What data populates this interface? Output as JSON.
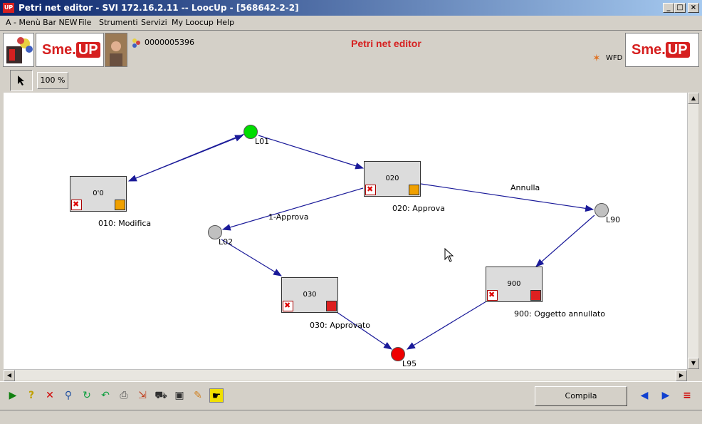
{
  "window": {
    "title": "Petri net editor - SVI 172.16.2.11 -- LoocUp - [568642-2-2]",
    "app_icon_text": "UP",
    "buttons": {
      "minimize": "_",
      "maximize": "□",
      "close": "×"
    }
  },
  "menu": {
    "items": [
      "A - Menù Bar NEW",
      "File",
      "Strumenti",
      "Servizi",
      "My Loocup",
      "Help"
    ]
  },
  "header": {
    "user_code": "0000005396",
    "title": "Petri net editor",
    "wfd": "WFD",
    "logo_left": {
      "text": "Sme.",
      "badge": "UP"
    },
    "logo_right": {
      "text": "Sme.",
      "badge": "UP"
    }
  },
  "toolbar": {
    "zoom": "100 %"
  },
  "graph": {
    "places": [
      {
        "id": "L01",
        "label": "L01",
        "color": "#00dd00"
      },
      {
        "id": "L02",
        "label": "L02",
        "color": "#c0c0c0"
      },
      {
        "id": "L90",
        "label": "L90",
        "color": "#c0c0c0"
      },
      {
        "id": "L95",
        "label": "L95",
        "color": "#ee0000"
      }
    ],
    "transitions": [
      {
        "code": "0'0",
        "label": "010: Modifica",
        "status_color": "#f0a000"
      },
      {
        "code": "020",
        "label": "020: Approva",
        "status_color": "#f0a000"
      },
      {
        "code": "030",
        "label": "030: Approvato",
        "status_color": "#dd2020"
      },
      {
        "code": "900",
        "label": "900: Oggetto annullato",
        "status_color": "#dd2020"
      }
    ],
    "edge_labels": [
      "1-Approva",
      "Annulla"
    ],
    "edge_color": "#1a1a99"
  },
  "bottom": {
    "compila_label": "Compila",
    "icons": [
      "play-icon",
      "help-icon",
      "delete-icon",
      "search-icon",
      "refresh-icon",
      "undo-icon",
      "print-icon",
      "export-icon",
      "cart-icon",
      "image-icon",
      "wand-icon",
      "pointer-icon"
    ]
  }
}
